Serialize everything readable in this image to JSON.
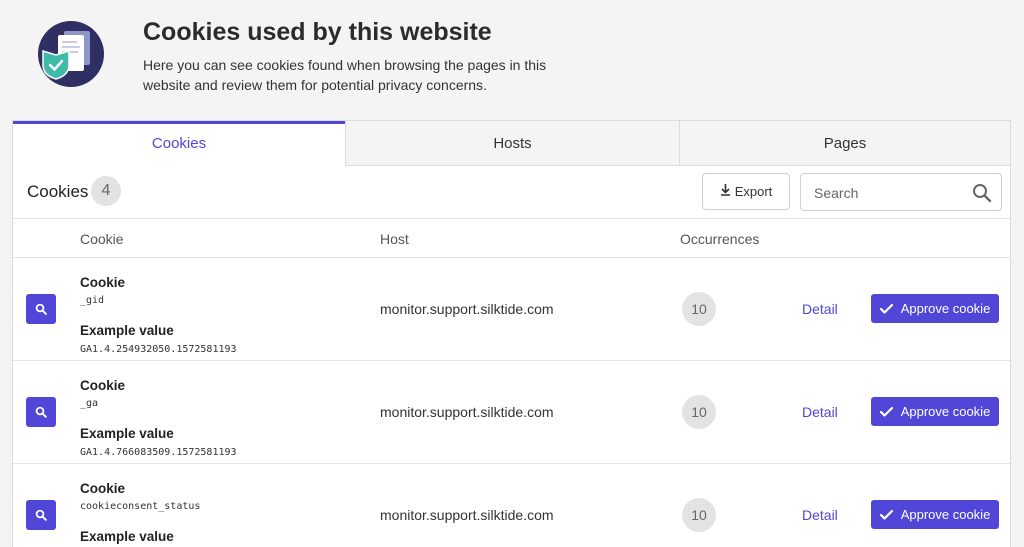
{
  "header": {
    "title": "Cookies used by this website",
    "subtitle": "Here you can see cookies found when browsing the pages in this website and review them for potential privacy concerns."
  },
  "tabs": [
    {
      "label": "Cookies",
      "active": true
    },
    {
      "label": "Hosts",
      "active": false
    },
    {
      "label": "Pages",
      "active": false
    }
  ],
  "toolbar": {
    "title": "Cookies",
    "count": "4",
    "export_label": "Export",
    "search_placeholder": "Search"
  },
  "columns": {
    "cookie": "Cookie",
    "host": "Host",
    "occurrences": "Occurrences"
  },
  "rows": [
    {
      "cookie_label": "Cookie",
      "cookie_name": "_gid",
      "example_label": "Example value",
      "example_value": "GA1.4.254932050.1572581193",
      "host": "monitor.support.silktide.com",
      "occurrences": "10",
      "detail_label": "Detail",
      "approve_label": "Approve cookie"
    },
    {
      "cookie_label": "Cookie",
      "cookie_name": "_ga",
      "example_label": "Example value",
      "example_value": "GA1.4.766083509.1572581193",
      "host": "monitor.support.silktide.com",
      "occurrences": "10",
      "detail_label": "Detail",
      "approve_label": "Approve cookie"
    },
    {
      "cookie_label": "Cookie",
      "cookie_name": "cookieconsent_status",
      "example_label": "Example value",
      "example_value": "",
      "host": "monitor.support.silktide.com",
      "occurrences": "10",
      "detail_label": "Detail",
      "approve_label": "Approve cookie"
    }
  ],
  "icons": {
    "logo": "document-shield-icon",
    "export": "download-icon",
    "search": "search-icon",
    "inspect": "magnifier-icon",
    "approve": "checkmark-icon"
  },
  "colors": {
    "accent": "#5046d8",
    "background": "#f4f4f5",
    "logo_bg": "#2f2f63",
    "shield": "#3dbba8"
  }
}
